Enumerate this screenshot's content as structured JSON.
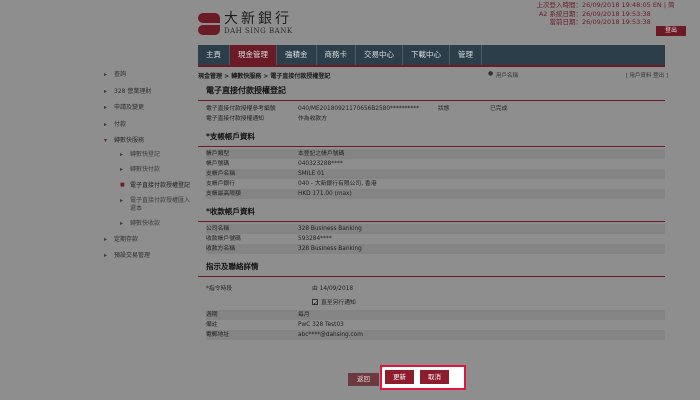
{
  "header": {
    "bank_cn": "大新銀行",
    "bank_en": "DAH SING BANK",
    "login_labels": [
      "上次登入時間：",
      "A2 系統日期：",
      "當前日期："
    ],
    "login_values": [
      "26/09/2018 19:48:05",
      "26/09/2018 19:53:38",
      "26/09/2018 19:53:38"
    ],
    "lang": "EN | 简",
    "logout": "登出"
  },
  "nav": [
    "主頁",
    "現金管理",
    "強積金",
    "商務卡",
    "交易中心",
    "下載中心",
    "管理"
  ],
  "sidebar": {
    "items": [
      "查詢",
      "328 營業理財",
      "申請及變更",
      "付款",
      "轉數快服務"
    ],
    "sub": [
      "轉數快登記",
      "轉數快付款",
      "電子直接付款授權登記",
      "電子直接付款授權匯入還本",
      "轉數快收款"
    ],
    "items2": [
      "定期存款",
      "預設交易管理"
    ]
  },
  "breadcrumb": "現金管理 > 轉數快服務 > 電子直接付款授權登記",
  "user": {
    "icon": "user-icon",
    "name": "用戶名稱",
    "links": "[ 用戶資料  登出 ]"
  },
  "form": {
    "title": "電子直接付款授權登記",
    "ref_label": "電子直接付款授權參考編號",
    "ref_value": "040/ME20180921170656B2580**********",
    "status_label": "狀態",
    "status_value": "已完成",
    "channel_label": "電子直接付款授權通知",
    "channel_value": "作為收款方",
    "payer_title": "*支帳帳戶資料",
    "payer_rows": [
      {
        "k": "帳戶類型",
        "v": "本登記之帳戶號碼"
      },
      {
        "k": "帳戶號碼",
        "v": "040323288****"
      },
      {
        "k": "支帳戶名稱",
        "v": "SMILE 01"
      },
      {
        "k": "支帳戶銀行",
        "v": "040 - 大新銀行有限公司, 香港"
      },
      {
        "k": "支帳最高限額",
        "v": "HKD 171.00 (max)"
      }
    ],
    "payee_title": "*收款帳戶資料",
    "payee_rows": [
      {
        "k": "公司名稱",
        "v": "328 Business Banking"
      },
      {
        "k": "收款帳戶號碼",
        "v": "593284****"
      },
      {
        "k": "收款方名稱",
        "v": "328 Business Banking"
      }
    ],
    "instr_title": "指示及聯絡詳情",
    "instr_rows": [
      {
        "k": "*指令時段",
        "v": "由    14/09/2018"
      },
      {
        "k": "",
        "v": "直至另行通知"
      },
      {
        "k": "週期",
        "v": "每月"
      },
      {
        "k": "備註",
        "v": "PwC 328 Test03"
      },
      {
        "k": "電郵地址",
        "v": "abc****@dahsing.com"
      }
    ]
  },
  "buttons": {
    "back": "返回",
    "update": "更新",
    "cancel": "取消"
  }
}
